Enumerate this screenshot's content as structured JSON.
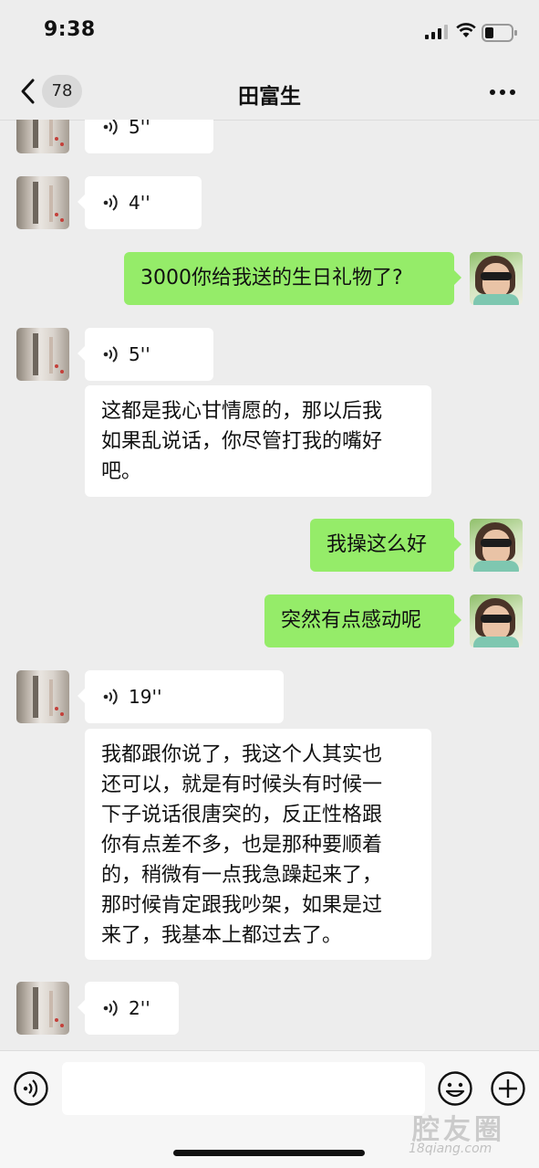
{
  "status_bar": {
    "time": "9:38"
  },
  "nav": {
    "unread_count": "78",
    "title": "田富生"
  },
  "messages": [
    {
      "kind": "voice",
      "side": "in",
      "duration": "5''"
    },
    {
      "kind": "voice",
      "side": "in",
      "duration": "4''"
    },
    {
      "kind": "text",
      "side": "out",
      "text": "3000你给我送的生日礼物了?"
    },
    {
      "kind": "voice",
      "side": "in",
      "duration": "5''"
    },
    {
      "kind": "text",
      "side": "in",
      "lines": [
        "这都是我心甘情愿的，那以后我",
        "如果乱说话，你尽管打我的嘴好",
        "吧。"
      ]
    },
    {
      "kind": "text",
      "side": "out",
      "text": "我操这么好"
    },
    {
      "kind": "text",
      "side": "out",
      "text": "突然有点感动呢"
    },
    {
      "kind": "voice",
      "side": "in",
      "duration": "19''"
    },
    {
      "kind": "text",
      "side": "in",
      "lines": [
        "我都跟你说了，我这个人其实也",
        "还可以，就是有时候头有时候一",
        "下子说话很唐突的，反正性格跟",
        "你有点差不多，也是那种要顺着",
        "的，稍微有一点我急躁起来了，",
        "那时候肯定跟我吵架，如果是过",
        "来了，我基本上都过去了。"
      ]
    },
    {
      "kind": "voice",
      "side": "in",
      "duration": "2''"
    }
  ],
  "input": {
    "value": ""
  },
  "watermark": {
    "text": "腔友圈",
    "url": "18qiang.com"
  },
  "icons": [
    "back-icon",
    "more-icon",
    "signal-icon",
    "wifi-icon",
    "battery-icon",
    "voice-wave-icon",
    "voice-toggle-icon",
    "emoji-icon",
    "plus-icon"
  ],
  "colors": {
    "background": "#ededed",
    "incoming_bubble": "#ffffff",
    "outgoing_bubble": "#95ec69"
  }
}
